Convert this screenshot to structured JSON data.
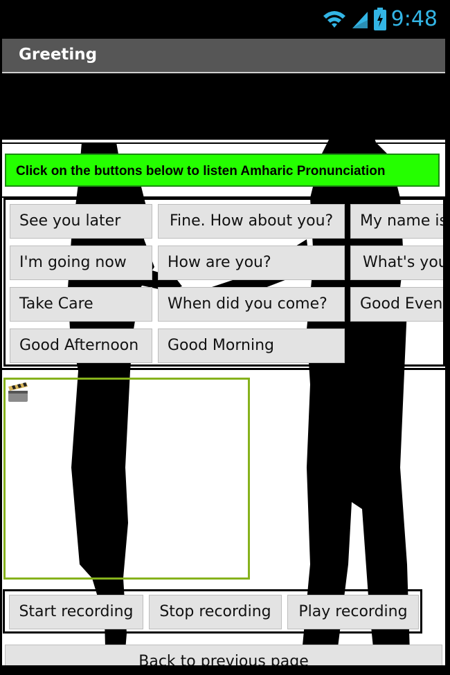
{
  "status_bar": {
    "time": "9:48",
    "accent": "#33b5e5"
  },
  "title_bar": {
    "title": "Greeting"
  },
  "instruction": {
    "text": "Click on the buttons below to listen Amharic Pronunciation",
    "color": "#25ff00"
  },
  "phrase_buttons": [
    "See you later",
    "Fine. How about you?",
    "My name is",
    "I'm going now",
    "How are you?",
    "What's your",
    "Take Care",
    "When did you come?",
    "Good Evening",
    "Good Afternoon",
    "Good Morning"
  ],
  "video": {
    "icon": "clapperboard-icon",
    "border_color": "#86b21c"
  },
  "recording": {
    "start": "Start recording",
    "stop": "Stop recording",
    "play": "Play recording"
  },
  "back_button": "Back to previous page"
}
